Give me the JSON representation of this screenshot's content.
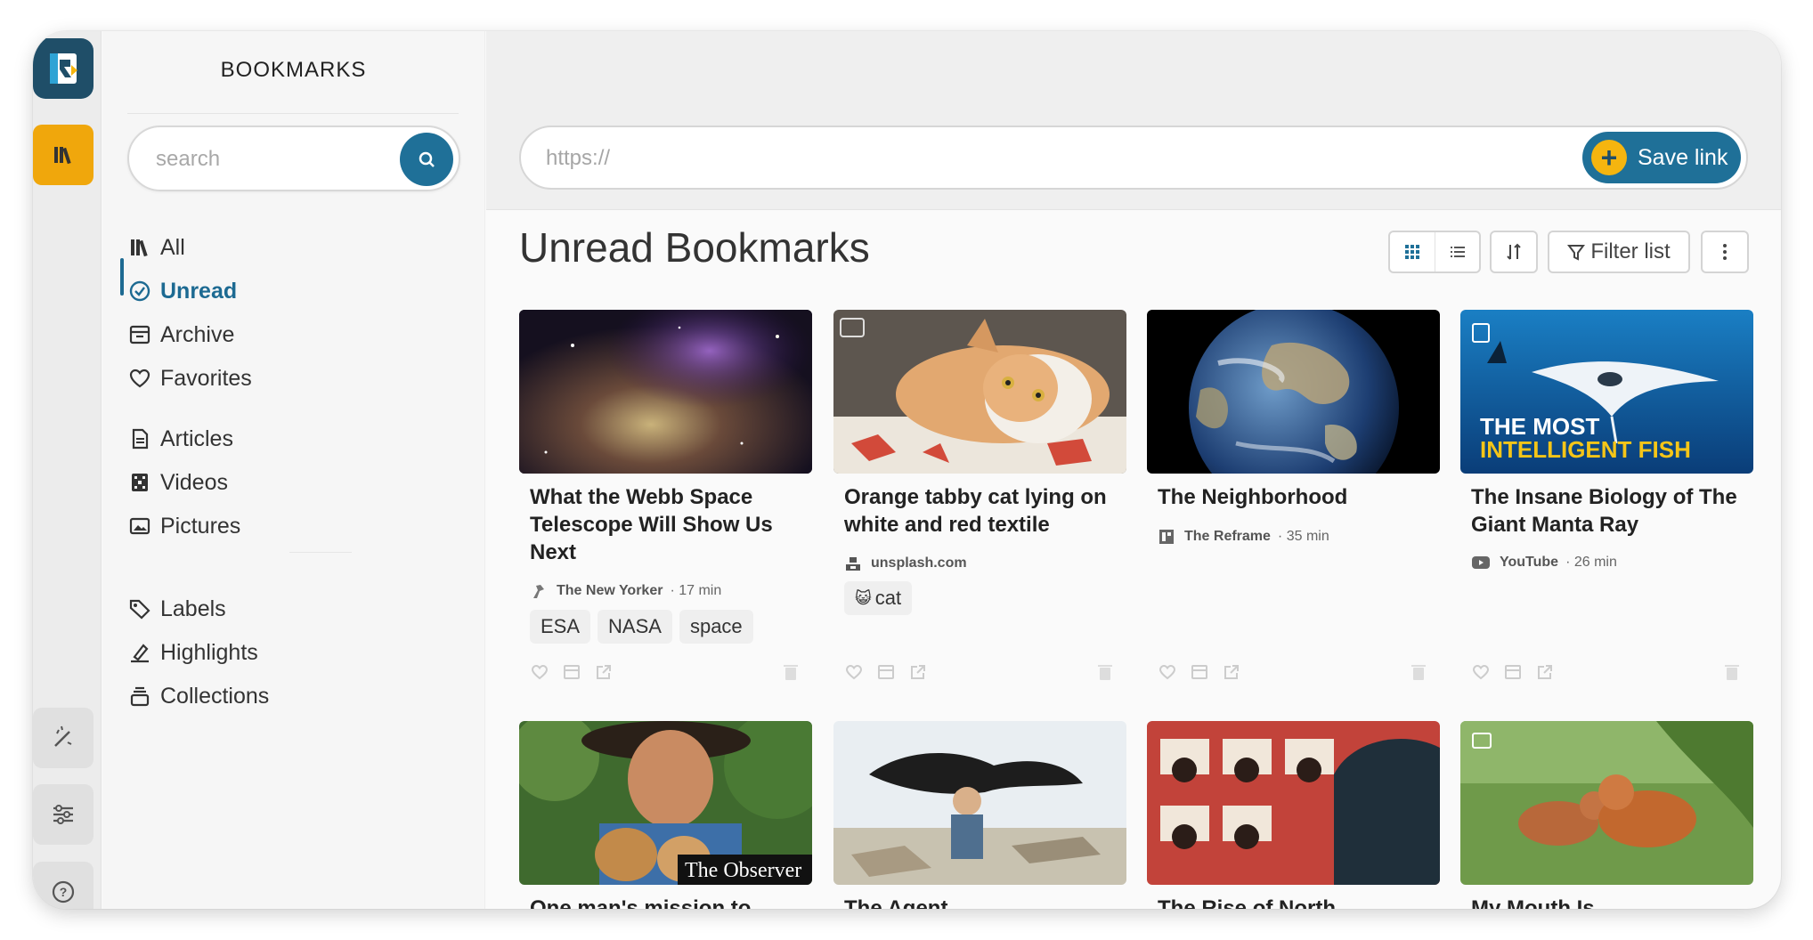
{
  "sidebar": {
    "title": "BOOKMARKS",
    "search_placeholder": "search",
    "nav": [
      {
        "label": "All",
        "icon": "library-icon"
      },
      {
        "label": "Unread",
        "icon": "check-circle-icon",
        "active": true
      },
      {
        "label": "Archive",
        "icon": "archive-icon"
      },
      {
        "label": "Favorites",
        "icon": "heart-icon"
      },
      {
        "label": "Articles",
        "icon": "document-icon"
      },
      {
        "label": "Videos",
        "icon": "film-icon"
      },
      {
        "label": "Pictures",
        "icon": "image-icon"
      },
      {
        "label": "Labels",
        "icon": "tag-icon"
      },
      {
        "label": "Highlights",
        "icon": "highlighter-icon"
      },
      {
        "label": "Collections",
        "icon": "stack-icon"
      }
    ]
  },
  "main": {
    "url_placeholder": "https://",
    "save_label": "Save link",
    "title": "Unread Bookmarks",
    "filter_label": "Filter list"
  },
  "cards": [
    {
      "title": "What the Webb Space Telescope Will Show Us Next",
      "source": "The New Yorker",
      "read_time": "· 17 min",
      "labels": [
        "ESA",
        "NASA",
        "space"
      ],
      "thumb": "nebula"
    },
    {
      "title": "Orange tabby cat lying on white and red textile",
      "source": "unsplash.com",
      "read_time": "",
      "labels": [
        "cat"
      ],
      "label_emoji": "😺",
      "thumb": "cat"
    },
    {
      "title": "The Neighborhood",
      "source": "The Reframe",
      "read_time": "· 35 min",
      "labels": [],
      "thumb": "earth"
    },
    {
      "title": "The Insane Biology of The Giant Manta Ray",
      "source": "YouTube",
      "read_time": "· 26 min",
      "labels": [],
      "thumb": "manta",
      "thumb_text_1": "THE MOST",
      "thumb_text_2": "INTELLIGENT FISH"
    },
    {
      "title": "One man's mission to save",
      "thumb": "observer",
      "thumb_text_1": "The Observer"
    },
    {
      "title": "The Agent",
      "thumb": "agent"
    },
    {
      "title": "The Rise of North",
      "thumb": "rise"
    },
    {
      "title": "My Mouth Is",
      "thumb": "foxes"
    }
  ],
  "colors": {
    "accent": "#1f7098",
    "rail_active": "#f0a70c",
    "save_plus": "#f5b50f"
  }
}
